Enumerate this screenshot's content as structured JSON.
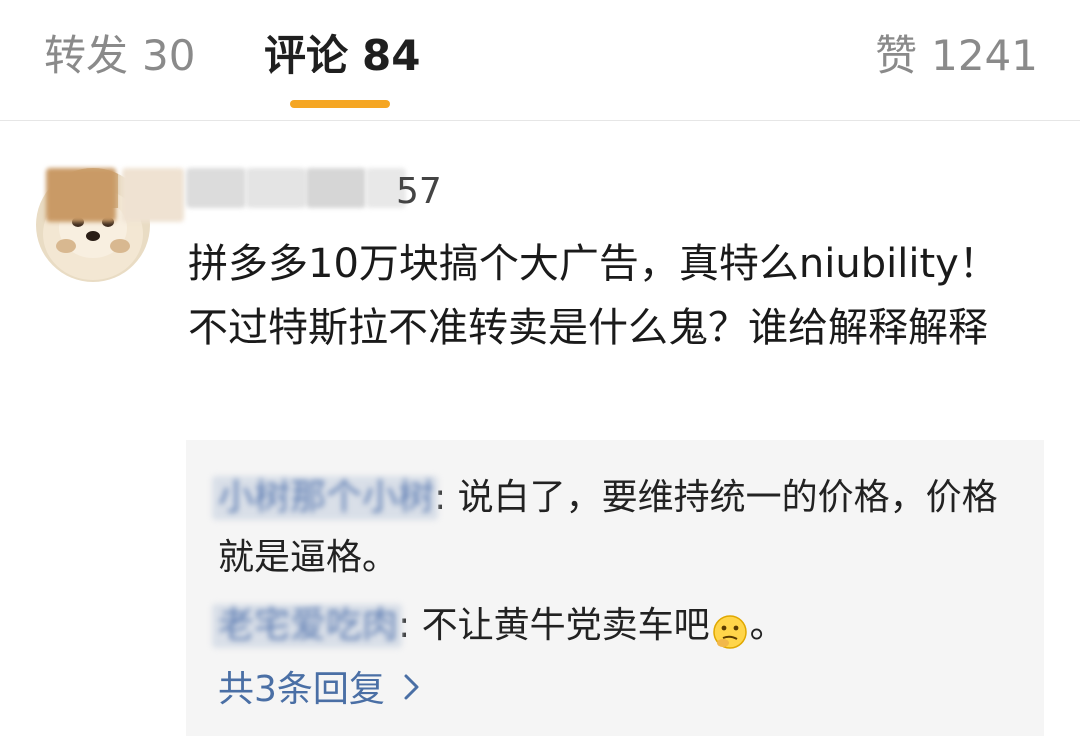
{
  "tabs": {
    "repost": {
      "label": "转发",
      "count": "30"
    },
    "comment": {
      "label": "评论",
      "count": "84"
    },
    "like": {
      "label": "赞",
      "count": "1241"
    }
  },
  "comment": {
    "username_suffix": "57",
    "text": "拼多多10万块搞个大广告，真特么niubility！不过特斯拉不准转卖是什么鬼？谁给解释解释"
  },
  "replies": [
    {
      "author": "小树那个小树",
      "text": "说白了，要维持统一的价格，价格就是逼格。"
    },
    {
      "author": "老宅爱吃肉",
      "text": "不让黄牛党卖车吧",
      "emoji": "thinking-face-icon",
      "suffix": "。"
    }
  ],
  "more_replies_label": "共3条回复",
  "colors": {
    "accent": "#f5a623",
    "link": "#5b7bb2",
    "reply_bg": "#f5f5f5"
  }
}
